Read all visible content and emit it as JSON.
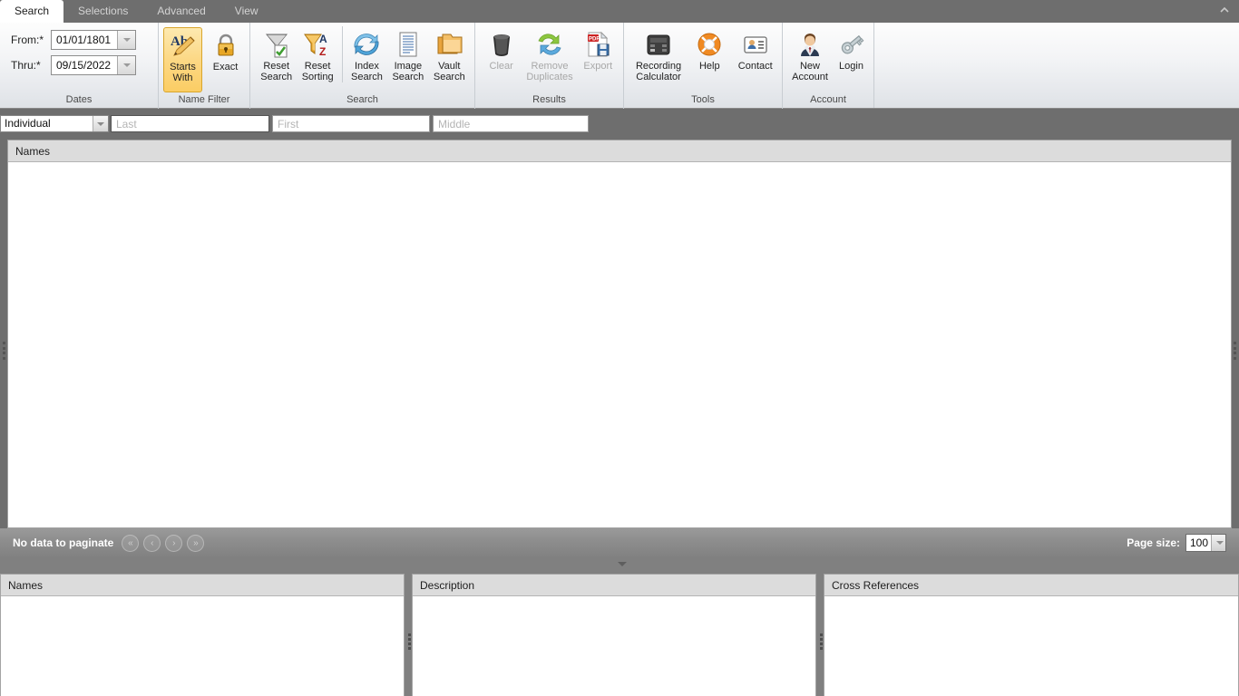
{
  "tabs": [
    {
      "label": "Search",
      "active": true
    },
    {
      "label": "Selections",
      "active": false
    },
    {
      "label": "Advanced",
      "active": false
    },
    {
      "label": "View",
      "active": false
    }
  ],
  "ribbon": {
    "collapse_glyph": "^",
    "groups": [
      {
        "title": "Dates",
        "fields": [
          {
            "label": "From:*",
            "value": "01/01/1801"
          },
          {
            "label": "Thru:*",
            "value": "09/15/2022"
          }
        ]
      },
      {
        "title": "Name Filter",
        "buttons": [
          {
            "label": "Starts\nWith",
            "line1": "Starts",
            "line2": "With",
            "icon": "ab-pencil-icon",
            "selected": true,
            "disabled": false
          },
          {
            "label": "Exact",
            "line1": "Exact",
            "line2": "",
            "icon": "padlock-icon",
            "selected": false,
            "disabled": false
          }
        ]
      },
      {
        "title": "Search",
        "buttons": [
          {
            "line1": "Reset",
            "line2": "Search",
            "icon": "funnel-check-icon",
            "selected": false,
            "disabled": false
          },
          {
            "line1": "Reset",
            "line2": "Sorting",
            "icon": "funnel-az-icon",
            "selected": false,
            "disabled": false
          },
          {
            "line1": "Index",
            "line2": "Search",
            "icon": "refresh-arrows-icon",
            "selected": false,
            "disabled": false
          },
          {
            "line1": "Image",
            "line2": "Search",
            "icon": "document-icon",
            "selected": false,
            "disabled": false
          },
          {
            "line1": "Vault",
            "line2": "Search",
            "icon": "folders-icon",
            "selected": false,
            "disabled": false
          }
        ]
      },
      {
        "title": "Results",
        "buttons": [
          {
            "line1": "Clear",
            "line2": "",
            "icon": "trash-icon",
            "selected": false,
            "disabled": true
          },
          {
            "line1": "Remove",
            "line2": "Duplicates",
            "icon": "recycle-icon",
            "selected": false,
            "disabled": true
          },
          {
            "line1": "Export",
            "line2": "",
            "icon": "pdf-save-icon",
            "selected": false,
            "disabled": true
          }
        ]
      },
      {
        "title": "Tools",
        "buttons": [
          {
            "line1": "Recording",
            "line2": "Calculator",
            "icon": "calculator-icon",
            "selected": false,
            "disabled": false
          },
          {
            "line1": "Help",
            "line2": "",
            "icon": "lifering-icon",
            "selected": false,
            "disabled": false
          },
          {
            "line1": "Contact",
            "line2": "",
            "icon": "contact-card-icon",
            "selected": false,
            "disabled": false
          }
        ]
      },
      {
        "title": "Account",
        "buttons": [
          {
            "line1": "New",
            "line2": "Account",
            "icon": "person-suit-icon",
            "selected": false,
            "disabled": false
          },
          {
            "line1": "Login",
            "line2": "",
            "icon": "key-icon",
            "selected": false,
            "disabled": false
          }
        ]
      }
    ]
  },
  "search_fields": {
    "type_value": "Individual",
    "last_placeholder": "Last",
    "last_value": "",
    "first_placeholder": "First",
    "first_value": "",
    "middle_placeholder": "Middle",
    "middle_value": ""
  },
  "grid": {
    "column_header": "Names",
    "rows": []
  },
  "pager": {
    "status": "No data to paginate",
    "first_glyph": "«",
    "prev_glyph": "‹",
    "next_glyph": "›",
    "last_glyph": "»",
    "page_size_label": "Page size:",
    "page_size_value": "100"
  },
  "bottom_panels": [
    {
      "title": "Names"
    },
    {
      "title": "Description"
    },
    {
      "title": "Cross References"
    }
  ],
  "colors": {
    "chrome": "#6e6e6e",
    "ribbon_bg": "#f1f3f5",
    "selected_button": "#fbcd64",
    "header_bg": "#dcdcdc",
    "pager_bg": "#8e8e8e"
  }
}
